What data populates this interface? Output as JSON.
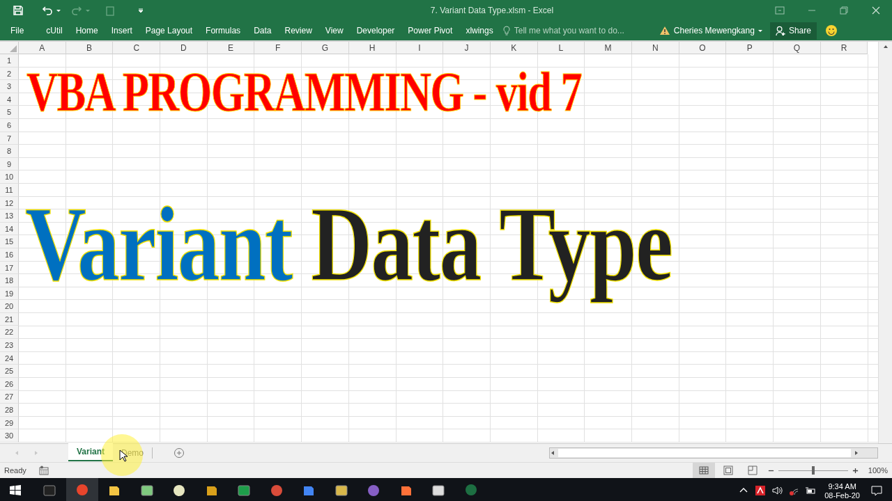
{
  "window": {
    "title": "7. Variant Data Type.xlsm - Excel"
  },
  "ribbon": {
    "file": "File",
    "tabs": [
      {
        "label": "cUtil",
        "selected": false
      },
      {
        "label": "Home",
        "selected": false
      },
      {
        "label": "Insert",
        "selected": false
      },
      {
        "label": "Page Layout",
        "selected": false
      },
      {
        "label": "Formulas",
        "selected": false
      },
      {
        "label": "Data",
        "selected": false
      },
      {
        "label": "Review",
        "selected": false
      },
      {
        "label": "View",
        "selected": false
      },
      {
        "label": "Developer",
        "selected": false
      },
      {
        "label": "Power Pivot",
        "selected": false
      },
      {
        "label": "xlwings",
        "selected": false
      }
    ],
    "search": {
      "placeholder": "Tell me what you want to do..."
    },
    "account": "Cheries Mewengkang",
    "share": "Share"
  },
  "sheet": {
    "columns": [
      "A",
      "B",
      "C",
      "D",
      "E",
      "F",
      "G",
      "H",
      "I",
      "J",
      "K",
      "L",
      "M",
      "N",
      "O",
      "P",
      "Q",
      "R"
    ],
    "rows": [
      "1",
      "2",
      "3",
      "4",
      "5",
      "6",
      "7",
      "8",
      "9",
      "10",
      "11",
      "12",
      "13",
      "14",
      "15",
      "16",
      "17",
      "18",
      "19",
      "20",
      "21",
      "22",
      "23",
      "24",
      "25",
      "26",
      "27",
      "28",
      "29",
      "30"
    ],
    "title": {
      "text": "VBA PROGRAMMING - vid 7",
      "color": "#ff0000"
    },
    "heading": [
      {
        "text": "Variant",
        "color": "#0070c0"
      },
      {
        "text": "Data Type",
        "color": "#222222"
      }
    ]
  },
  "sheet_tabs": [
    {
      "label": "Variant",
      "selected": true
    },
    {
      "label": "Demo",
      "selected": false
    }
  ],
  "status_bar": {
    "status": "Ready",
    "zoom": "100%",
    "zoom_slider": {
      "level": 0.5
    }
  },
  "taskbar": {
    "time": "9:34 AM",
    "date": "08-Feb-20"
  }
}
